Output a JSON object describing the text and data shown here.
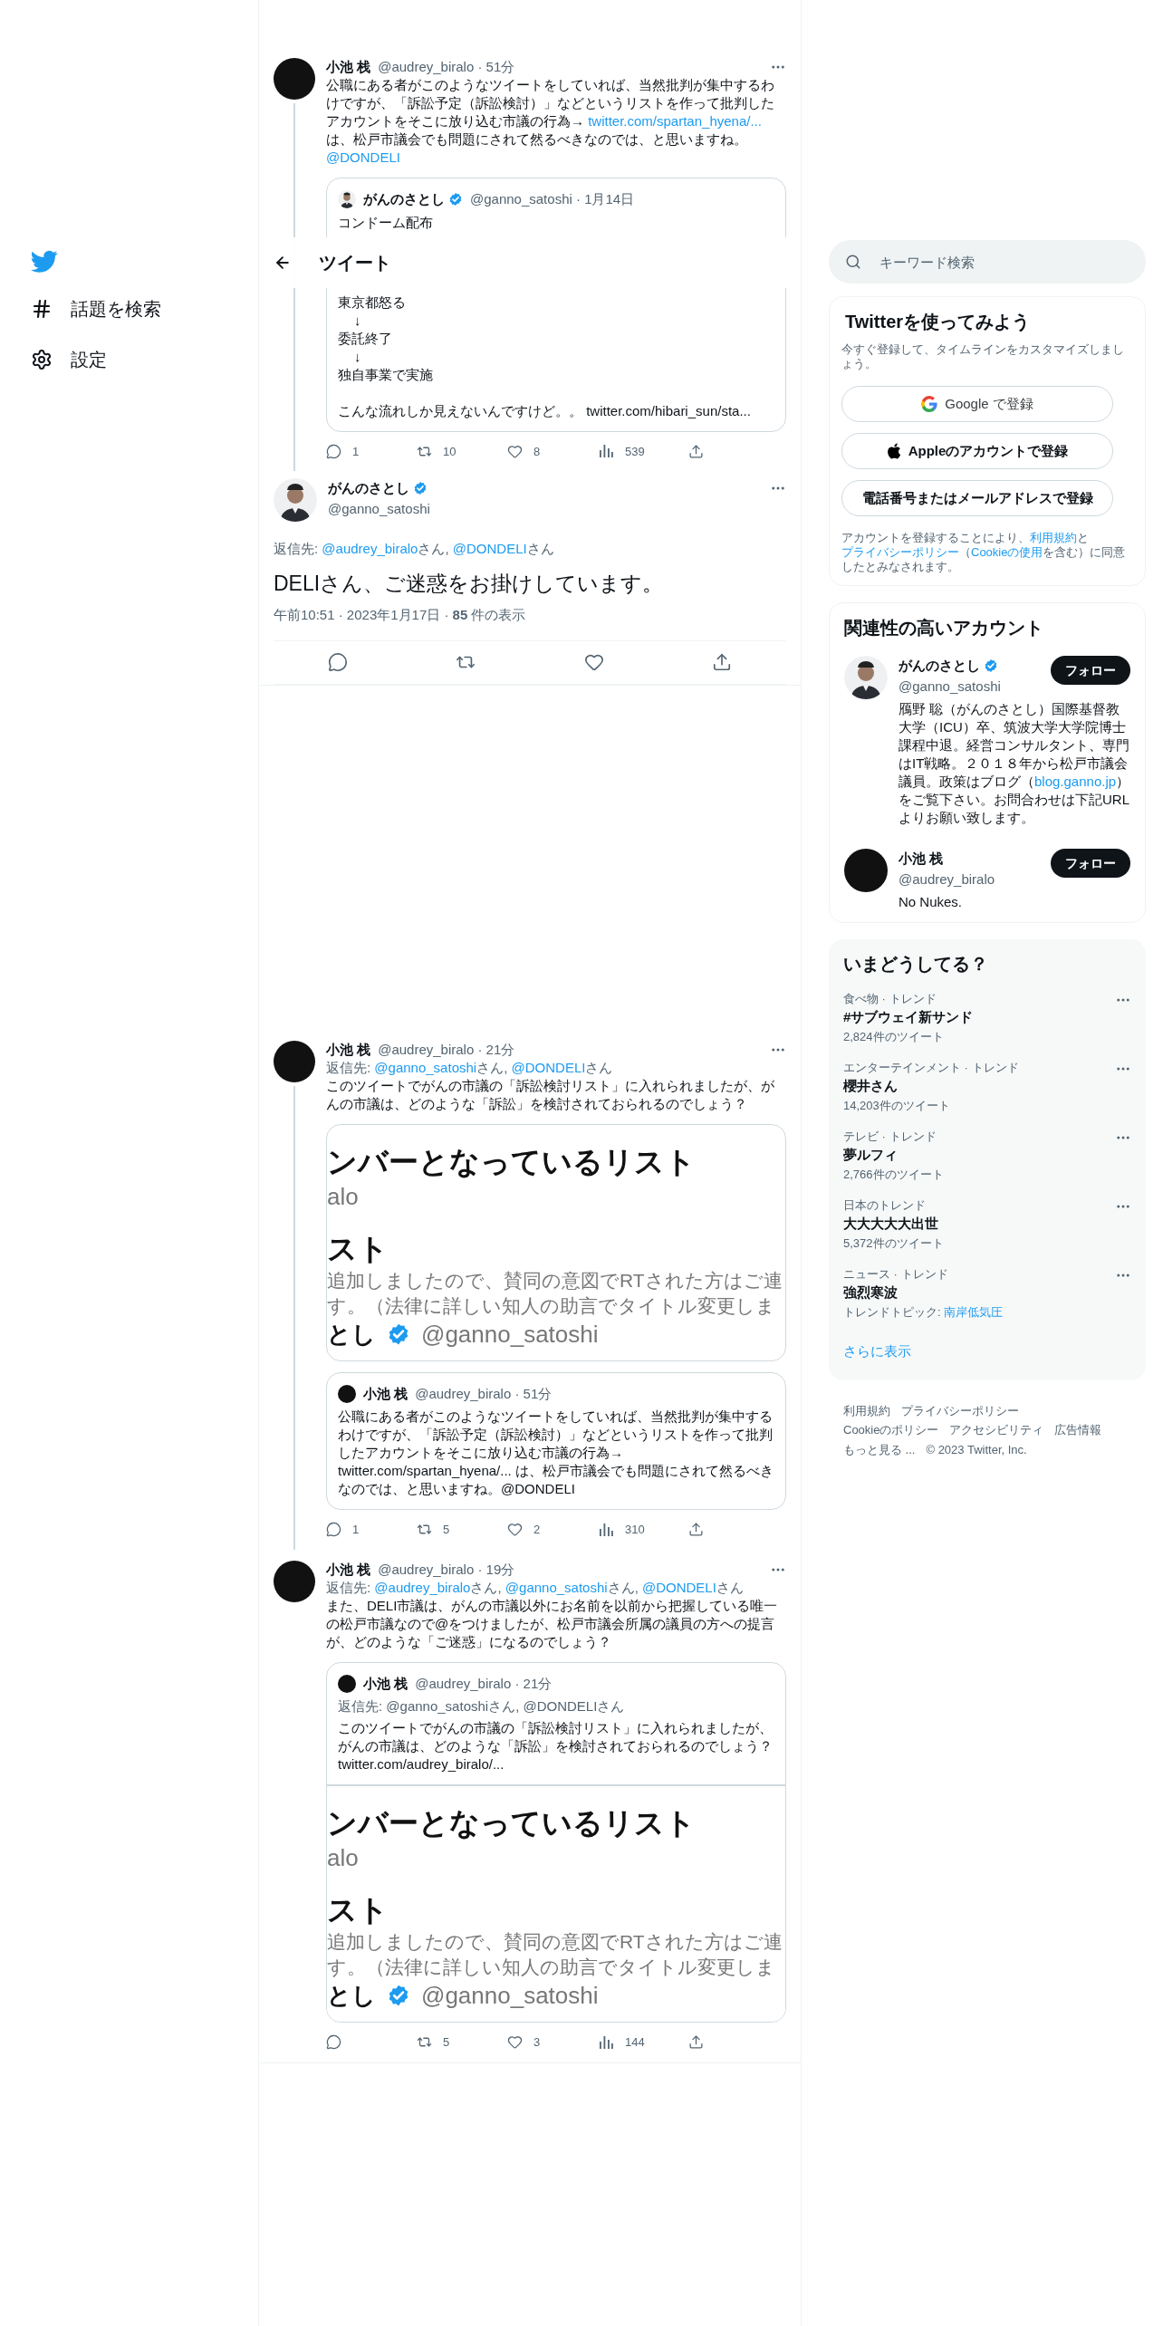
{
  "nav": {
    "items": [
      {
        "kind": "explore",
        "label": "話題を検索"
      },
      {
        "kind": "settings",
        "label": "設定"
      }
    ]
  },
  "header": {
    "title": "ツイート"
  },
  "tweets": [
    {
      "kind": "reply",
      "thread_continues": true,
      "avatar": {
        "kind": "dark"
      },
      "name": "小池 栈",
      "verified": false,
      "handle_time": "@audrey_biralo · 51分",
      "body": [
        {
          "kind": "text",
          "text": "公職にある者がこのようなツイートをしていれば、当然批判が集中するわけですが、「訴訟予定（訴訟検討）」などというリストを作って批判したアカウントをそこに放り込む市議の行為→ "
        },
        {
          "kind": "link",
          "text": "twitter.com/spartan_hyena/..."
        },
        {
          "kind": "text",
          "text": " は、松戸市議会でも問題にされて然るべきなのでは、と思いますね。 "
        },
        {
          "kind": "link",
          "text": "@DONDELI"
        }
      ],
      "quote": {
        "avatar": {
          "kind": "person"
        },
        "name": "がんのさとし",
        "verified": true,
        "handle_time": "@ganno_satoshi · 1月14日",
        "lines_top": [
          {
            "kind": "text",
            "text": "コンドーム配布"
          }
        ],
        "lines": [
          {
            "kind": "text",
            "text": "東京都怒る"
          },
          {
            "kind": "arrow",
            "text": "↓"
          },
          {
            "kind": "text",
            "text": "委託終了"
          },
          {
            "kind": "arrow",
            "text": "↓"
          },
          {
            "kind": "text",
            "text": "独自事業で実施"
          },
          {
            "kind": "paragraph",
            "text": "こんな流れしか見えないんですけど。。 twitter.com/hibari_sun/sta..."
          }
        ]
      },
      "stats": [
        {
          "kind": "reply",
          "count": "1"
        },
        {
          "kind": "retweet",
          "count": "10"
        },
        {
          "kind": "like",
          "count": "8"
        },
        {
          "kind": "views",
          "count": "539"
        },
        {
          "kind": "share"
        }
      ]
    },
    {
      "kind": "focus",
      "thread_continues": false,
      "avatar": {
        "kind": "person"
      },
      "name": "がんのさとし",
      "verified": true,
      "handle": "@ganno_satoshi",
      "reply_to": {
        "label": "返信先: ",
        "mentions": [
          {
            "handle": "@audrey_biralo",
            "suffix": "さん, "
          },
          {
            "handle": "@DONDELI",
            "suffix": "さん"
          }
        ]
      },
      "text": "DELIさん、ご迷惑をお掛けしています。",
      "meta": "午前10:51 · 2023年1月17日 · **85** 件の表示",
      "stats": [
        {
          "kind": "reply"
        },
        {
          "kind": "retweet"
        },
        {
          "kind": "like"
        },
        {
          "kind": "share"
        }
      ]
    },
    {
      "kind": "reply",
      "thread_continues": true,
      "avatar": {
        "kind": "dark"
      },
      "name": "小池 栈",
      "verified": false,
      "handle_time": "@audrey_biralo · 21分",
      "reply_to": {
        "label": "返信先: ",
        "mentions": [
          {
            "handle": "@ganno_satoshi",
            "suffix": "さん, "
          },
          {
            "handle": "@DONDELI",
            "suffix": "さん"
          }
        ]
      },
      "body": [
        {
          "kind": "text",
          "text": "このツイートでがんの市議の「訴訟検討リスト」に入れられましたが、がんの市議は、どのような「訴訟」を検討されておられるのでしょう？"
        }
      ],
      "media": {
        "title": "ンバーとなっているリスト",
        "subtitle": "alo",
        "heading": "スト",
        "lines": [
          "追加しましたので、賛同の意図でRTされた方はご連",
          "す。（法律に詳しい知人の助言でタイトル変更しま"
        ],
        "author_name": "とし",
        "author_verified": true,
        "author_handle": "@ganno_satoshi"
      },
      "quote": {
        "avatar": {
          "kind": "dark"
        },
        "name": "小池 栈",
        "verified": false,
        "handle_time": "@audrey_biralo · 51分",
        "text": "公職にある者がこのようなツイートをしていれば、当然批判が集中するわけですが、「訴訟予定（訴訟検討）」などというリストを作って批判したアカウントをそこに放り込む市議の行為→ twitter.com/spartan_hyena/... は、松戸市議会でも問題にされて然るべきなのでは、と思いますね。@DONDELI"
      },
      "stats": [
        {
          "kind": "reply",
          "count": "1"
        },
        {
          "kind": "retweet",
          "count": "5"
        },
        {
          "kind": "like",
          "count": "2"
        },
        {
          "kind": "views",
          "count": "310"
        },
        {
          "kind": "share"
        }
      ]
    },
    {
      "kind": "reply",
      "thread_continues": false,
      "avatar": {
        "kind": "dark"
      },
      "name": "小池 栈",
      "verified": false,
      "handle_time": "@audrey_biralo · 19分",
      "reply_to": {
        "label": "返信先: ",
        "mentions": [
          {
            "handle": "@audrey_biralo",
            "suffix": "さん, "
          },
          {
            "handle": "@ganno_satoshi",
            "suffix": "さん, "
          },
          {
            "handle": "@DONDELI",
            "suffix": "さん"
          }
        ]
      },
      "body": [
        {
          "kind": "text",
          "text": "また、DELI市議は、がんの市議以外にお名前を以前から把握している唯一の松戸市議なので@をつけましたが、松戸市議会所属の議員の方への提言が、どのような「ご迷惑」になるのでしょう？"
        }
      ],
      "quote": {
        "avatar": {
          "kind": "dark"
        },
        "name": "小池 栈",
        "verified": false,
        "handle_time": "@audrey_biralo · 21分",
        "reply_line": "返信先: @ganno_satoshiさん, @DONDELIさん",
        "text": "このツイートでがんの市議の「訴訟検討リスト」に入れられましたが、がんの市議は、どのような「訴訟」を検討されておられるのでしょう？",
        "link_line": "twitter.com/audrey_biralo/...",
        "media": {
          "title": "ンバーとなっているリスト",
          "subtitle": "alo",
          "heading": "スト",
          "lines": [
            "追加しましたので、賛同の意図でRTされた方はご連",
            "す。（法律に詳しい知人の助言でタイトル変更しま"
          ],
          "author_name": "とし",
          "author_verified": true,
          "author_handle": "@ganno_satoshi"
        }
      },
      "stats": [
        {
          "kind": "reply"
        },
        {
          "kind": "retweet",
          "count": "5"
        },
        {
          "kind": "like",
          "count": "3"
        },
        {
          "kind": "views",
          "count": "144"
        },
        {
          "kind": "share"
        }
      ]
    }
  ],
  "search": {
    "placeholder": "キーワード検索"
  },
  "signup": {
    "title": "Twitterを使ってみよう",
    "subtitle": "今すぐ登録して、タイムラインをカスタマイズしましょう。",
    "buttons": [
      {
        "kind": "google",
        "label": "Google で登録"
      },
      {
        "kind": "apple",
        "label": "Appleのアカウントで登録"
      },
      {
        "kind": "plain",
        "label": "電話番号またはメールアドレスで登録"
      }
    ],
    "legal": [
      {
        "kind": "text",
        "text": "アカウントを登録することにより、"
      },
      {
        "kind": "link",
        "text": "利用規約"
      },
      {
        "kind": "text",
        "text": "と"
      },
      {
        "kind": "link",
        "text": "プライバシーポリシー"
      },
      {
        "kind": "text",
        "text": "（"
      },
      {
        "kind": "link",
        "text": "Cookieの使用"
      },
      {
        "kind": "text",
        "text": "を含む）に同意したとみなされます。"
      }
    ]
  },
  "accounts": {
    "title": "関連性の高いアカウント",
    "items": [
      {
        "avatar": {
          "kind": "person"
        },
        "name": "がんのさとし",
        "verified": true,
        "handle": "@ganno_satoshi",
        "button": "フォロー",
        "bio": [
          {
            "kind": "text",
            "text": "鴈野 聡（がんのさとし）国際基督教大学（ICU）卒、筑波大学大学院博士課程中退。経営コンサルタント、専門はIT戦略。２０１８年から松戸市議会議員。政策はブログ（"
          },
          {
            "kind": "link",
            "text": "blog.ganno.jp"
          },
          {
            "kind": "text",
            "text": "）をご覧下さい。お問合わせは下記URLよりお願い致します。"
          }
        ]
      },
      {
        "avatar": {
          "kind": "dark"
        },
        "name": "小池 栈",
        "verified": false,
        "handle": "@audrey_biralo",
        "button": "フォロー",
        "bio": [
          {
            "kind": "text",
            "text": "No Nukes."
          }
        ]
      }
    ]
  },
  "trends": {
    "title": "いまどうしてる？",
    "items": [
      {
        "context": "食べ物 · トレンド",
        "name": "#サブウェイ新サンド",
        "count": "2,824件のツイート"
      },
      {
        "context": "エンターテインメント · トレンド",
        "name": "櫻井さん",
        "count": "14,203件のツイート"
      },
      {
        "context": "テレビ · トレンド",
        "name": "夢ルフィ",
        "count": "2,766件のツイート"
      },
      {
        "context": "日本のトレンド",
        "name": "大大大大大出世",
        "count": "5,372件のツイート"
      },
      {
        "context": "ニュース · トレンド",
        "name": "強烈寒波",
        "topic_label": "トレンドトピック: ",
        "topic": "南岸低気圧"
      }
    ],
    "more": "さらに表示"
  },
  "footer": [
    [
      "利用規約",
      "プライバシーポリシー"
    ],
    [
      "Cookieのポリシー",
      "アクセシビリティ",
      "広告情報"
    ],
    [
      "もっと見る ...",
      "© 2023 Twitter, Inc."
    ]
  ]
}
